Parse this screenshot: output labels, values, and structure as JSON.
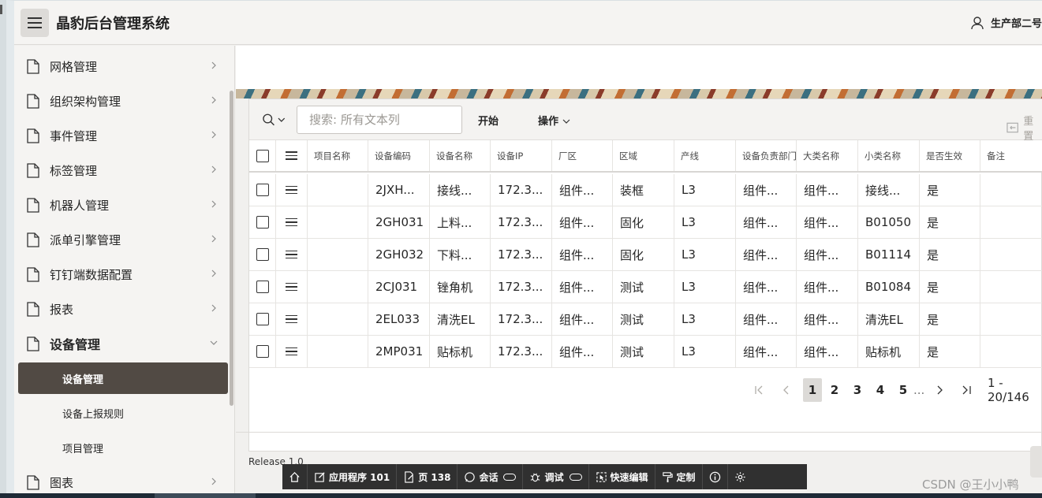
{
  "header": {
    "title": "晶豹后台管理系统",
    "user": "生产部二号"
  },
  "sidebar": {
    "items": [
      {
        "label": "网格管理"
      },
      {
        "label": "组织架构管理"
      },
      {
        "label": "事件管理"
      },
      {
        "label": "标签管理"
      },
      {
        "label": "机器人管理"
      },
      {
        "label": "派单引擎管理"
      },
      {
        "label": "钉钉端数据配置"
      },
      {
        "label": "报表"
      },
      {
        "label": "设备管理"
      }
    ],
    "sub_items": [
      {
        "label": "设备管理"
      },
      {
        "label": "设备上报规则"
      },
      {
        "label": "项目管理"
      }
    ],
    "last_item": {
      "label": "图表"
    }
  },
  "toolbar": {
    "search_placeholder": "搜索: 所有文本列",
    "go_label": "开始",
    "actions_label": "操作",
    "reset_label": "重置"
  },
  "table": {
    "columns": [
      "项目名称",
      "设备编码",
      "设备名称",
      "设备IP",
      "厂区",
      "区域",
      "产线",
      "设备负责部门",
      "大类名称",
      "小类名称",
      "是否生效",
      "备注"
    ],
    "rows": [
      [
        "",
        "2JXH...",
        "接线...",
        "172.3...",
        "组件...",
        "装框",
        "L3",
        "组件...",
        "组件...",
        "接线...",
        "是",
        ""
      ],
      [
        "",
        "2GH031",
        "上料...",
        "172.3...",
        "组件...",
        "固化",
        "L3",
        "组件...",
        "组件...",
        "B01050",
        "是",
        ""
      ],
      [
        "",
        "2GH032",
        "下料...",
        "172.3...",
        "组件...",
        "固化",
        "L3",
        "组件...",
        "组件...",
        "B01114",
        "是",
        ""
      ],
      [
        "",
        "2CJ031",
        "锉角机",
        "172.3...",
        "组件...",
        "测试",
        "L3",
        "组件...",
        "组件...",
        "B01084",
        "是",
        ""
      ],
      [
        "",
        "2EL033",
        "清洗EL",
        "172.3...",
        "组件...",
        "测试",
        "L3",
        "组件...",
        "组件...",
        "清洗EL",
        "是",
        ""
      ],
      [
        "",
        "2MP031",
        "贴标机",
        "172.3...",
        "组件...",
        "测试",
        "L3",
        "组件...",
        "组件...",
        "贴标机",
        "是",
        ""
      ]
    ]
  },
  "pagination": {
    "first": "|<",
    "prev": "<",
    "pages": [
      "1",
      "2",
      "3",
      "4",
      "5"
    ],
    "current": "1",
    "ellipsis": "...",
    "next": ">",
    "last": ">|",
    "range": "1 - 20/146"
  },
  "footer": {
    "release": "Release 1.0"
  },
  "devbar": {
    "home": "",
    "app": "应用程序 101",
    "page": "页 138",
    "session": "会话",
    "debug": "调试",
    "quick_edit": "快速编辑",
    "customize": "定制"
  },
  "watermark": "CSDN @王小小鸭"
}
